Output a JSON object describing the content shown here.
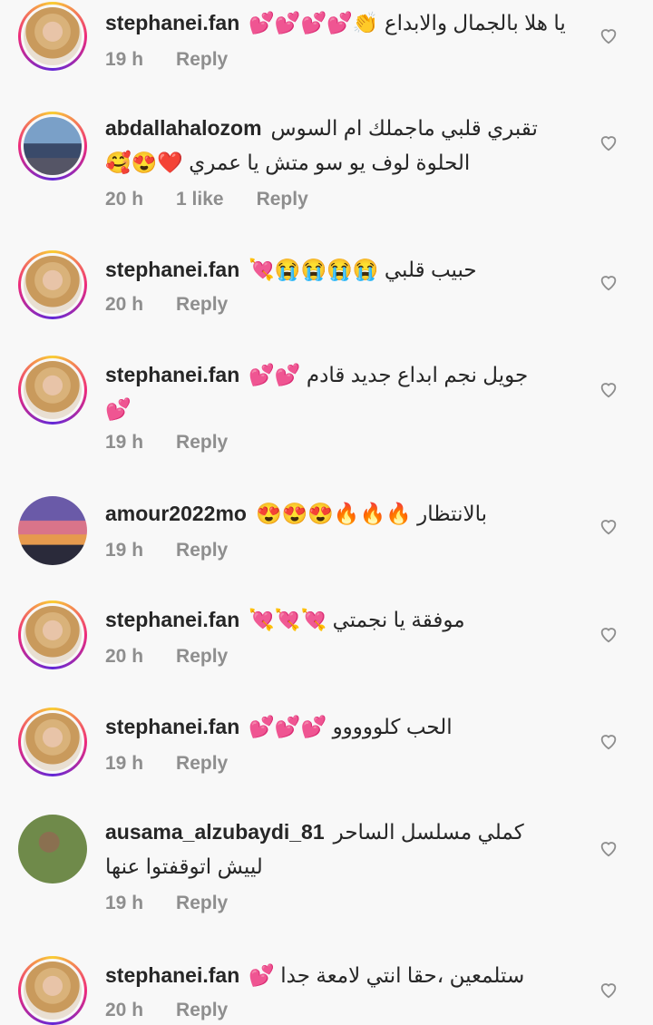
{
  "comments": [
    {
      "user": "stephanei.fan",
      "text": "يا هلا بالجمال والابداع 👏💕💕💕💕",
      "time": "19 h",
      "reply": "Reply"
    },
    {
      "user": "abdallahalozom",
      "text": "تقبري قلبي ماجملك ام السوس",
      "text2": "الحلوة لوف يو سو متش يا عمري ❤️😍🥰",
      "time": "20 h",
      "likes": "1 like",
      "reply": "Reply"
    },
    {
      "user": "stephanei.fan",
      "text": "حبيب قلبي 😭😭😭😭💘",
      "time": "20 h",
      "reply": "Reply"
    },
    {
      "user": "stephanei.fan",
      "text": "جويل نجم ابداع جديد قادم 💕💕",
      "text2": "💕",
      "time": "19 h",
      "reply": "Reply"
    },
    {
      "user": "amour2022mo",
      "text": "بالانتظار 🔥🔥🔥😍😍😍",
      "time": "19 h",
      "reply": "Reply"
    },
    {
      "user": "stephanei.fan",
      "text": "موفقة يا نجمتي 💘💘💘",
      "time": "20 h",
      "reply": "Reply"
    },
    {
      "user": "stephanei.fan",
      "text": "الحب كلووووو 💕💕💕",
      "time": "19 h",
      "reply": "Reply"
    },
    {
      "user": "ausama_alzubaydi_81",
      "text": "كملي مسلسل الساحر",
      "text2": "لييش اتوقفتوا عنها",
      "time": "19 h",
      "reply": "Reply"
    },
    {
      "user": "stephanei.fan",
      "text": "ستلمعين ،حقا انتي لامعة جدا 💕",
      "time": "20 h",
      "reply": "Reply"
    }
  ]
}
